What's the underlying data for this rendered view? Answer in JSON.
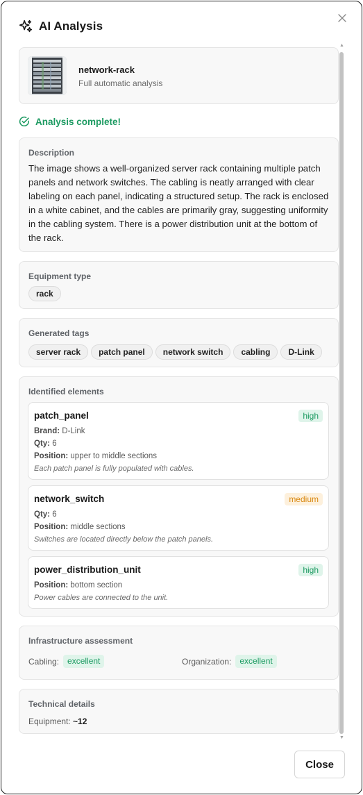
{
  "dialog": {
    "title": "AI Analysis",
    "title_icon": "sparkles-icon",
    "close_icon": "close-icon",
    "close_button_label": "Close"
  },
  "file": {
    "name": "network-rack",
    "subtitle": "Full automatic analysis"
  },
  "status": {
    "text": "Analysis complete!",
    "color": "#1c9a61"
  },
  "description": {
    "label": "Description",
    "text": "The image shows a well-organized server rack containing multiple patch panels and network switches. The cabling is neatly arranged with clear labeling on each panel, indicating a structured setup. The rack is enclosed in a white cabinet, and the cables are primarily gray, suggesting uniformity in the cabling system. There is a power distribution unit at the bottom of the rack."
  },
  "equipment": {
    "label": "Equipment type",
    "value": "rack"
  },
  "tags": {
    "label": "Generated tags",
    "items": [
      "server rack",
      "patch panel",
      "network switch",
      "cabling",
      "D-Link"
    ]
  },
  "elements": {
    "label": "Identified elements",
    "items": [
      {
        "name": "patch_panel",
        "confidence": "high",
        "brand_label": "Brand:",
        "brand": "D-Link",
        "qty_label": "Qty:",
        "qty": "6",
        "position_label": "Position:",
        "position": "upper to middle sections",
        "note": "Each patch panel is fully populated with cables."
      },
      {
        "name": "network_switch",
        "confidence": "medium",
        "qty_label": "Qty:",
        "qty": "6",
        "position_label": "Position:",
        "position": "middle sections",
        "note": "Switches are located directly below the patch panels."
      },
      {
        "name": "power_distribution_unit",
        "confidence": "high",
        "position_label": "Position:",
        "position": "bottom section",
        "note": "Power cables are connected to the unit."
      }
    ]
  },
  "infrastructure": {
    "label": "Infrastructure assessment",
    "cabling_label": "Cabling:",
    "cabling_value": "excellent",
    "organization_label": "Organization:",
    "organization_value": "excellent"
  },
  "technical": {
    "label": "Technical details",
    "equipment_label": "Equipment:",
    "equipment_value": "~12"
  }
}
